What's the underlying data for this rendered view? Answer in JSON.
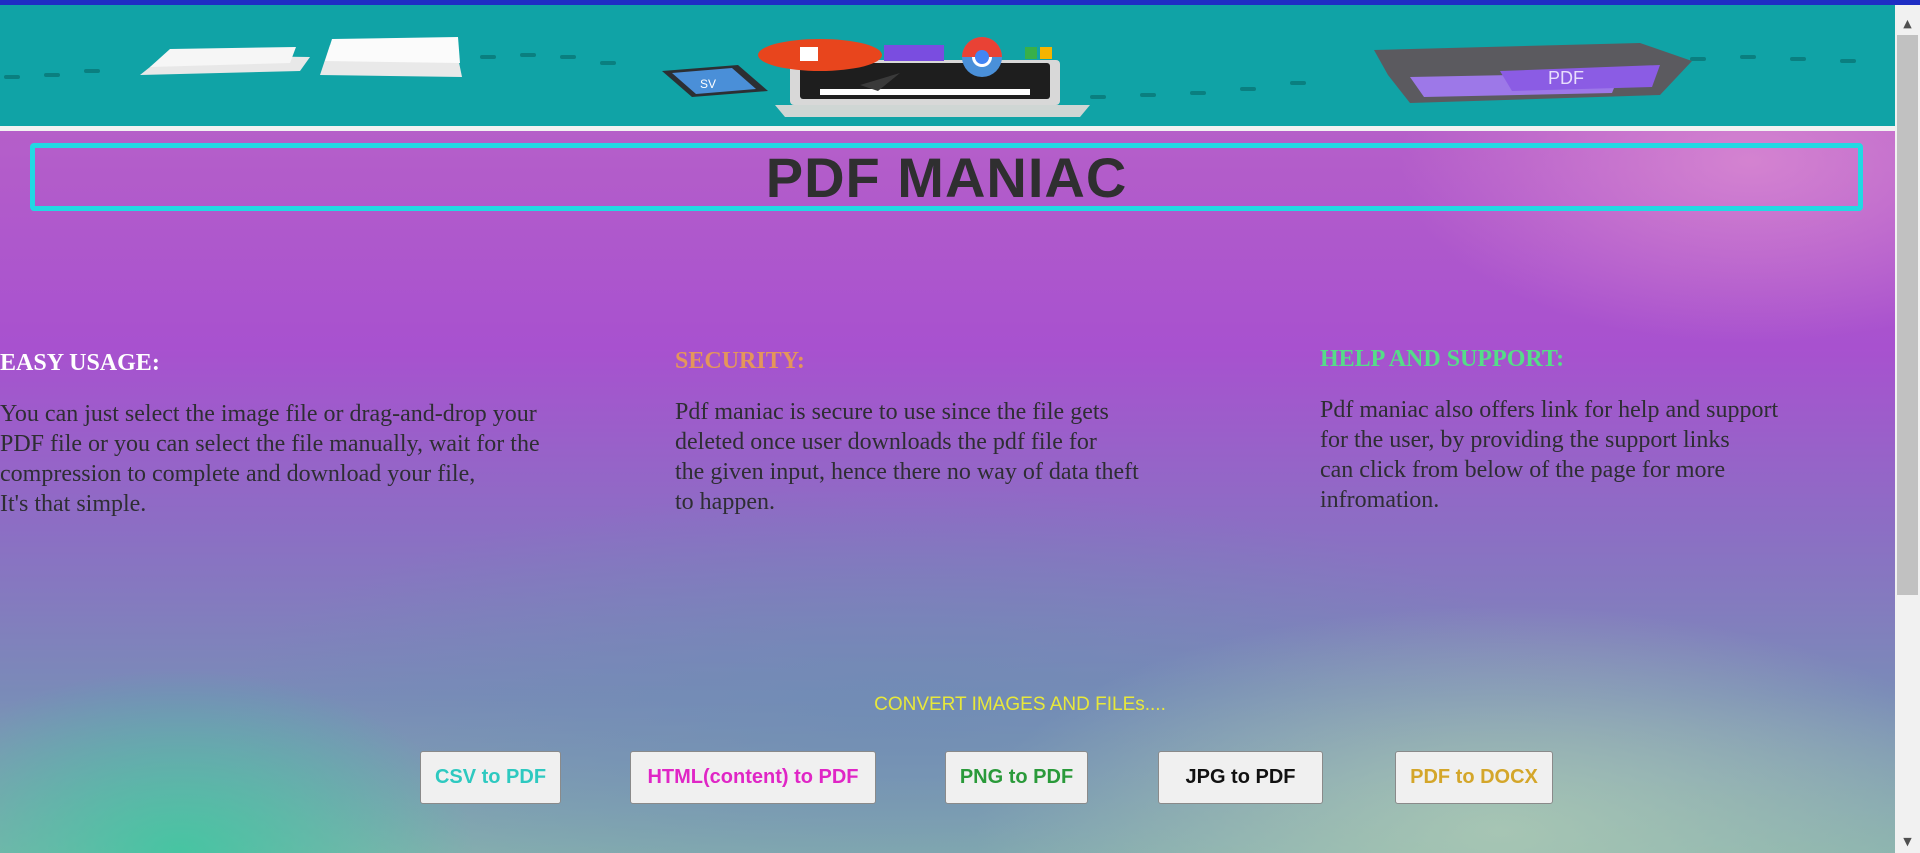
{
  "banner": {
    "illustration_icons": [
      "stack-of-papers-icon",
      "csv-file-icon",
      "office-logo-icon",
      "browser-logo-icon",
      "laptop-icon",
      "cursor-icon",
      "pdf-folder-icon"
    ],
    "illustration_labels": {
      "csv": "SV",
      "pdf": "PDF"
    },
    "background_color": "#10a3a6"
  },
  "header": {
    "title": "PDF MANIAC",
    "title_border_color": "#22d9e3"
  },
  "features": [
    {
      "heading": "EASY USAGE:",
      "heading_color": "#ffffff",
      "lines": [
        "You can just select the image file or drag-and-drop your",
        "PDF file or you can select the file manually, wait for the",
        "compression to complete and download your file,",
        "It's that simple."
      ]
    },
    {
      "heading": "SECURITY:",
      "heading_color": "#e4965a",
      "lines": [
        "Pdf maniac is secure to use since the file gets",
        "deleted once user downloads the pdf file for",
        "the given input, hence there no way of data theft",
        "to happen."
      ]
    },
    {
      "heading": "HELP AND SUPPORT:",
      "heading_color": "#55dd88",
      "lines": [
        "Pdf maniac also offers link for help and support",
        "for the user, by providing the support links",
        "can click from below of the page for more",
        "infromation."
      ]
    }
  ],
  "convert": {
    "heading": "CONVERT IMAGES AND FILEs....",
    "buttons": [
      {
        "label": "CSV to PDF",
        "color": "#2ec9c0"
      },
      {
        "label": "HTML(content) to PDF",
        "color": "#e026c6"
      },
      {
        "label": "PNG to PDF",
        "color": "#2a9a3a"
      },
      {
        "label": "JPG to PDF",
        "color": "#111111"
      },
      {
        "label": "PDF to DOCX",
        "color": "#d4a62a"
      }
    ]
  },
  "scrollbar": {
    "up_arrow_icon": "triangle-up-icon",
    "down_arrow_icon": "triangle-down-icon"
  }
}
